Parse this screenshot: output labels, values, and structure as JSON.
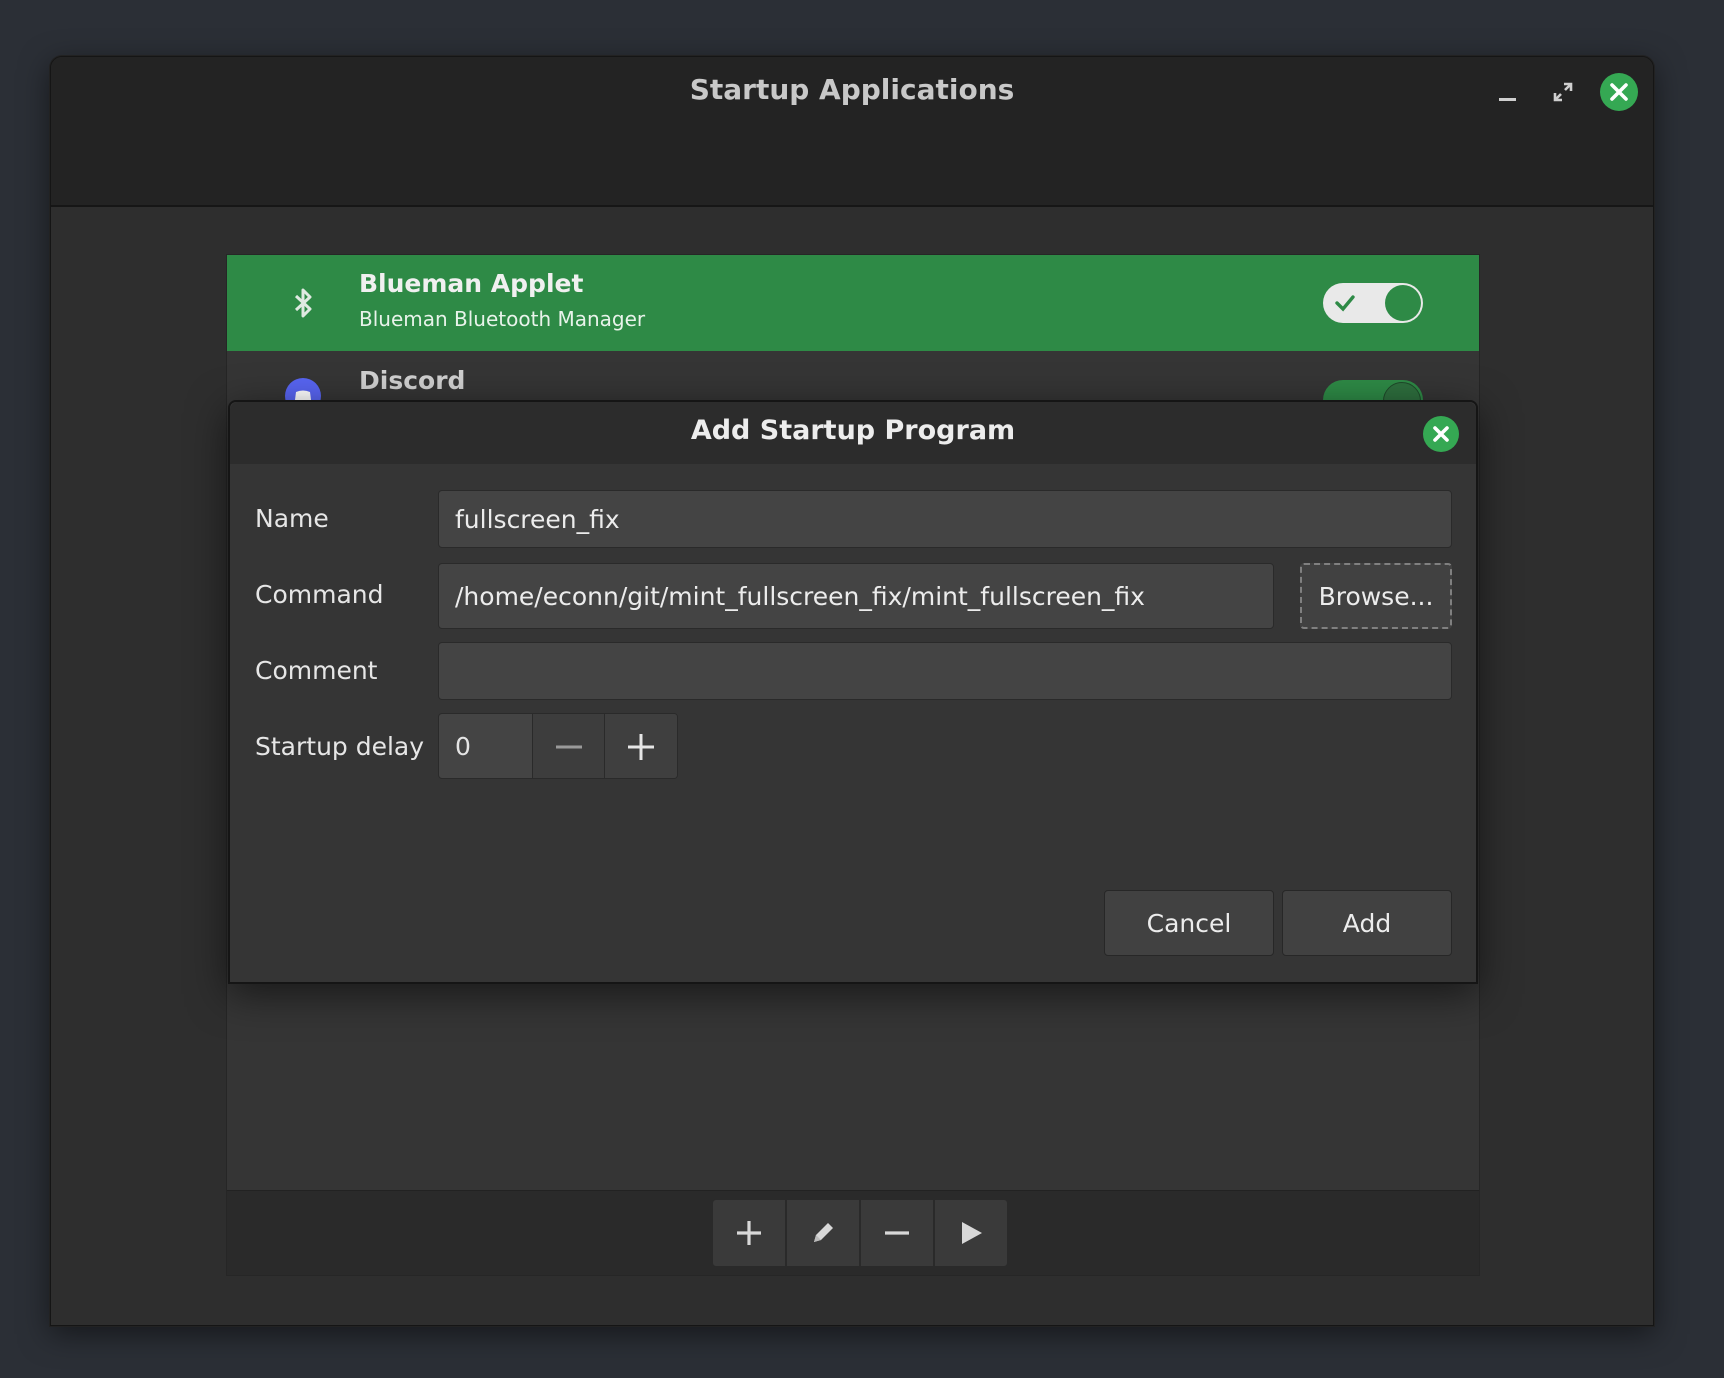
{
  "window": {
    "title": "Startup Applications",
    "minimize_icon": "minimize-icon",
    "maximize_icon": "maximize-icon",
    "close_icon": "close-icon"
  },
  "apps": [
    {
      "name": "Blueman Applet",
      "description": "Blueman Bluetooth Manager",
      "icon": "bluetooth-icon",
      "enabled": true,
      "selected": true
    },
    {
      "name": "Discord",
      "description": "",
      "icon": "discord-icon",
      "enabled": true,
      "selected": false
    }
  ],
  "toolbar": {
    "add_icon": "plus-icon",
    "edit_icon": "pencil-icon",
    "remove_icon": "minus-icon",
    "run_icon": "play-icon"
  },
  "dialog": {
    "title": "Add Startup Program",
    "name_label": "Name",
    "name_value": "fullscreen_fix",
    "command_label": "Command",
    "command_value": "/home/econn/git/mint_fullscreen_fix/mint_fullscreen_fix",
    "browse_label": "Browse...",
    "comment_label": "Comment",
    "comment_value": "",
    "delay_label": "Startup delay",
    "delay_value": "0",
    "cancel_label": "Cancel",
    "add_label": "Add"
  },
  "colors": {
    "accent": "#2e8a46",
    "close_button": "#35a853",
    "background": "#2b2f36"
  }
}
